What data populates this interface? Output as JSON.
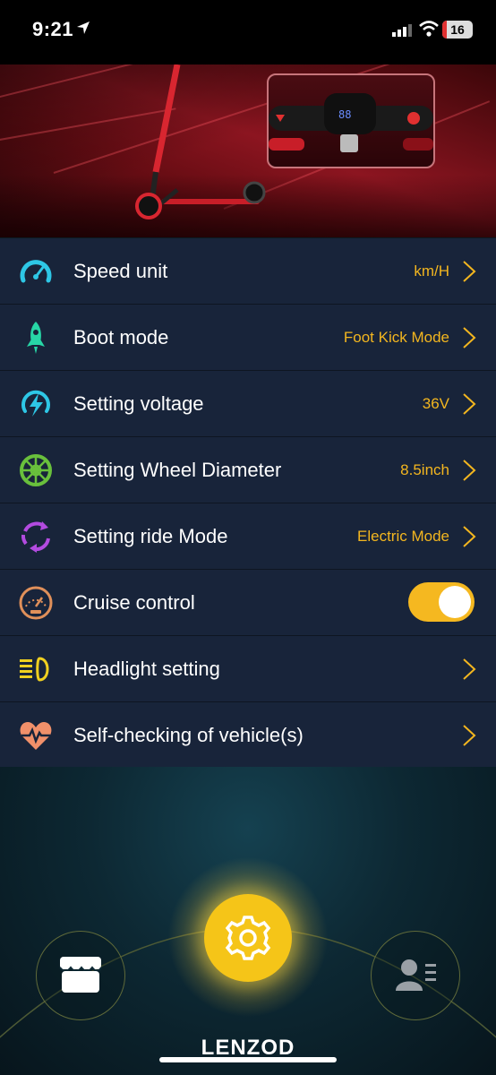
{
  "status_bar": {
    "time": "9:21",
    "battery": "16"
  },
  "settings": [
    {
      "label": "Speed unit",
      "value": "km/H",
      "icon": "speedometer-icon",
      "color": "#2ec7e6"
    },
    {
      "label": "Boot mode",
      "value": "Foot Kick Mode",
      "icon": "rocket-icon",
      "color": "#27d6a6"
    },
    {
      "label": "Setting voltage",
      "value": "36V",
      "icon": "voltage-icon",
      "color": "#2ec7e6"
    },
    {
      "label": "Setting Wheel Diameter",
      "value": "8.5inch",
      "icon": "wheel-icon",
      "color": "#69c03c"
    },
    {
      "label": "Setting ride Mode",
      "value": "Electric Mode",
      "icon": "cycle-arrows-icon",
      "color": "#b34be0"
    },
    {
      "label": "Cruise control",
      "value": "",
      "icon": "dashboard-gauge-icon",
      "color": "#e0905a",
      "toggle_on": true
    },
    {
      "label": "Headlight setting",
      "value": "",
      "icon": "headlight-icon",
      "color": "#f0d020"
    },
    {
      "label": "Self-checking of vehicle(s)",
      "value": "",
      "icon": "heartbeat-icon",
      "color": "#f0906a"
    }
  ],
  "colors": {
    "accent": "#f5c518",
    "value_text": "#f3b61f",
    "row_bg": "#18243a"
  },
  "bottom_nav": {
    "logo": "LENZOD",
    "left_icon": "store-icon",
    "center_icon": "gear-icon",
    "right_icon": "user-profile-icon"
  }
}
